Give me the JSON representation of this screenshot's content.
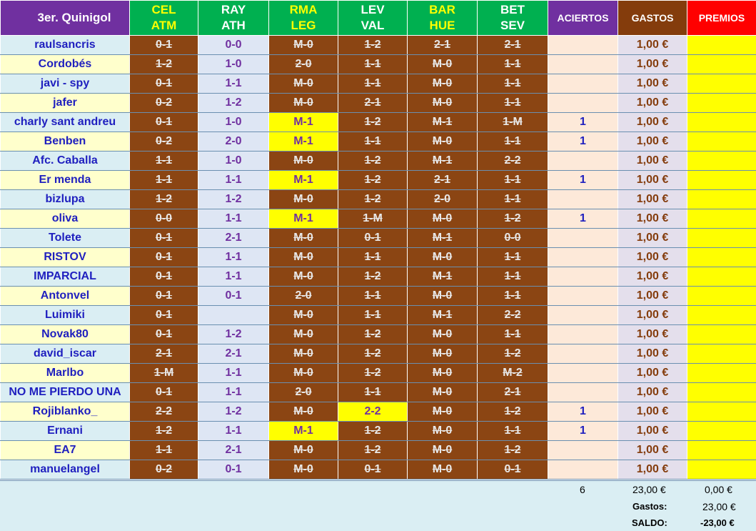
{
  "header": {
    "title": "3er. Quinigol",
    "matches": [
      {
        "home": "CEL",
        "away": "ATM"
      },
      {
        "home": "RAY",
        "away": "ATH"
      },
      {
        "home": "RMA",
        "away": "LEG"
      },
      {
        "home": "LEV",
        "away": "VAL"
      },
      {
        "home": "BAR",
        "away": "HUE"
      },
      {
        "home": "BET",
        "away": "SEV"
      }
    ],
    "aciertos": "ACIERTOS",
    "gastos": "GASTOS",
    "premios": "PREMIOS"
  },
  "rows": [
    {
      "name": "raulsancris",
      "picks": [
        "0-1",
        "0-0",
        "M-0",
        "1-2",
        "2-1",
        "2-1"
      ],
      "hits": [
        0,
        0,
        0,
        0,
        0,
        0
      ],
      "aciertos": "",
      "gasto": "1,00 €"
    },
    {
      "name": "Cordobés",
      "picks": [
        "1-2",
        "1-0",
        "2-0",
        "1-1",
        "M-0",
        "1-1"
      ],
      "hits": [
        0,
        0,
        0,
        0,
        0,
        0
      ],
      "aciertos": "",
      "gasto": "1,00 €"
    },
    {
      "name": "javi - spy",
      "picks": [
        "0-1",
        "1-1",
        "M-0",
        "1-1",
        "M-0",
        "1-1"
      ],
      "hits": [
        0,
        0,
        0,
        0,
        0,
        0
      ],
      "aciertos": "",
      "gasto": "1,00 €"
    },
    {
      "name": "jafer",
      "picks": [
        "0-2",
        "1-2",
        "M-0",
        "2-1",
        "M-0",
        "1-1"
      ],
      "hits": [
        0,
        0,
        0,
        0,
        0,
        0
      ],
      "aciertos": "",
      "gasto": "1,00 €"
    },
    {
      "name": "charly sant andreu",
      "picks": [
        "0-1",
        "1-0",
        "M-1",
        "1-2",
        "M-1",
        "1-M"
      ],
      "hits": [
        0,
        0,
        1,
        0,
        0,
        0
      ],
      "aciertos": "1",
      "gasto": "1,00 €"
    },
    {
      "name": "Benben",
      "picks": [
        "0-2",
        "2-0",
        "M-1",
        "1-1",
        "M-0",
        "1-1"
      ],
      "hits": [
        0,
        0,
        1,
        0,
        0,
        0
      ],
      "aciertos": "1",
      "gasto": "1,00 €"
    },
    {
      "name": "Afc. Caballa",
      "picks": [
        "1-1",
        "1-0",
        "M-0",
        "1-2",
        "M-1",
        "2-2"
      ],
      "hits": [
        0,
        0,
        0,
        0,
        0,
        0
      ],
      "aciertos": "",
      "gasto": "1,00 €"
    },
    {
      "name": "Er menda",
      "picks": [
        "1-1",
        "1-1",
        "M-1",
        "1-2",
        "2-1",
        "1-1"
      ],
      "hits": [
        0,
        0,
        1,
        0,
        0,
        0
      ],
      "aciertos": "1",
      "gasto": "1,00 €"
    },
    {
      "name": "bizlupa",
      "picks": [
        "1-2",
        "1-2",
        "M-0",
        "1-2",
        "2-0",
        "1-1"
      ],
      "hits": [
        0,
        0,
        0,
        0,
        0,
        0
      ],
      "aciertos": "",
      "gasto": "1,00 €"
    },
    {
      "name": "oliva",
      "picks": [
        "0-0",
        "1-1",
        "M-1",
        "1-M",
        "M-0",
        "1-2"
      ],
      "hits": [
        0,
        0,
        1,
        0,
        0,
        0
      ],
      "aciertos": "1",
      "gasto": "1,00 €"
    },
    {
      "name": "Tolete",
      "picks": [
        "0-1",
        "2-1",
        "M-0",
        "0-1",
        "M-1",
        "0-0"
      ],
      "hits": [
        0,
        0,
        0,
        0,
        0,
        0
      ],
      "aciertos": "",
      "gasto": "1,00 €"
    },
    {
      "name": "RISTOV",
      "picks": [
        "0-1",
        "1-1",
        "M-0",
        "1-1",
        "M-0",
        "1-1"
      ],
      "hits": [
        0,
        0,
        0,
        0,
        0,
        0
      ],
      "aciertos": "",
      "gasto": "1,00 €"
    },
    {
      "name": "IMPARCIAL",
      "picks": [
        "0-1",
        "1-1",
        "M-0",
        "1-2",
        "M-1",
        "1-1"
      ],
      "hits": [
        0,
        0,
        0,
        0,
        0,
        0
      ],
      "aciertos": "",
      "gasto": "1,00 €"
    },
    {
      "name": "Antonvel",
      "picks": [
        "0-1",
        "0-1",
        "2-0",
        "1-1",
        "M-0",
        "1-1"
      ],
      "hits": [
        0,
        0,
        0,
        0,
        0,
        0
      ],
      "aciertos": "",
      "gasto": "1,00 €"
    },
    {
      "name": "Luimiki",
      "picks": [
        "0-1",
        "",
        "M-0",
        "1-1",
        "M-1",
        "2-2"
      ],
      "hits": [
        0,
        0,
        0,
        0,
        0,
        0
      ],
      "aciertos": "",
      "gasto": "1,00 €"
    },
    {
      "name": "Novak80",
      "picks": [
        "0-1",
        "1-2",
        "M-0",
        "1-2",
        "M-0",
        "1-1"
      ],
      "hits": [
        0,
        0,
        0,
        0,
        0,
        0
      ],
      "aciertos": "",
      "gasto": "1,00 €"
    },
    {
      "name": "david_iscar",
      "picks": [
        "2-1",
        "2-1",
        "M-0",
        "1-2",
        "M-0",
        "1-2"
      ],
      "hits": [
        0,
        0,
        0,
        0,
        0,
        0
      ],
      "aciertos": "",
      "gasto": "1,00 €"
    },
    {
      "name": "Marlbo",
      "picks": [
        "1-M",
        "1-1",
        "M-0",
        "1-2",
        "M-0",
        "M-2"
      ],
      "hits": [
        0,
        0,
        0,
        0,
        0,
        0
      ],
      "aciertos": "",
      "gasto": "1,00 €"
    },
    {
      "name": "NO ME PIERDO UNA",
      "picks": [
        "0-1",
        "1-1",
        "2-0",
        "1-1",
        "M-0",
        "2-1"
      ],
      "hits": [
        0,
        0,
        0,
        0,
        0,
        0
      ],
      "aciertos": "",
      "gasto": "1,00 €"
    },
    {
      "name": "Rojiblanko_",
      "picks": [
        "2-2",
        "1-2",
        "M-0",
        "2-2",
        "M-0",
        "1-2"
      ],
      "hits": [
        0,
        0,
        0,
        1,
        0,
        0
      ],
      "aciertos": "1",
      "gasto": "1,00 €"
    },
    {
      "name": "Ernani",
      "picks": [
        "1-2",
        "1-1",
        "M-1",
        "1-2",
        "M-0",
        "1-1"
      ],
      "hits": [
        0,
        0,
        1,
        0,
        0,
        0
      ],
      "aciertos": "1",
      "gasto": "1,00 €"
    },
    {
      "name": "EA7",
      "picks": [
        "1-1",
        "2-1",
        "M-0",
        "1-2",
        "M-0",
        "1-2"
      ],
      "hits": [
        0,
        0,
        0,
        0,
        0,
        0
      ],
      "aciertos": "",
      "gasto": "1,00 €"
    },
    {
      "name": "manuelangel",
      "picks": [
        "0-2",
        "0-1",
        "M-0",
        "0-1",
        "M-0",
        "0-1"
      ],
      "hits": [
        0,
        0,
        0,
        0,
        0,
        0
      ],
      "aciertos": "",
      "gasto": "1,00 €"
    }
  ],
  "footer": {
    "total_aciertos": "6",
    "total_gastos": "23,00 €",
    "total_premios": "0,00 €",
    "gastos_label": "Gastos:",
    "gastos_value": "23,00 €",
    "saldo_label": "SALDO:",
    "saldo_value": "-23,00 €"
  },
  "colors": {
    "title_bg": "#7030a0",
    "match_bg": "#00b050",
    "struck_pick_bg": "#8b4513",
    "hit_pick_bg": "#ffff00",
    "premios_bg": "#ff0000"
  }
}
